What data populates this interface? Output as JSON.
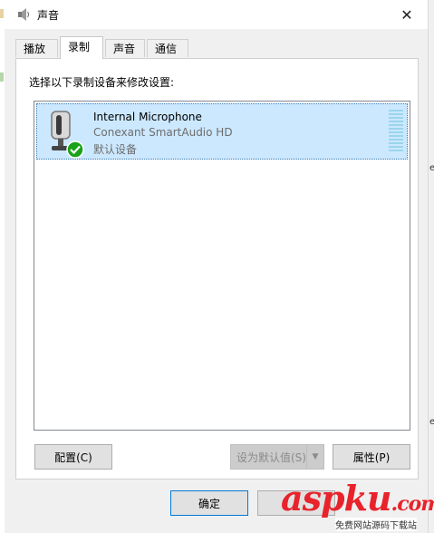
{
  "window": {
    "title": "声音",
    "close_glyph": "✕"
  },
  "tabs": [
    {
      "label": "播放",
      "active": false
    },
    {
      "label": "录制",
      "active": true
    },
    {
      "label": "声音",
      "active": false
    },
    {
      "label": "通信",
      "active": false
    }
  ],
  "recording": {
    "instruction": "选择以下录制设备来修改设置:",
    "devices": [
      {
        "name": "Internal Microphone",
        "driver": "Conexant SmartAudio HD",
        "status": "默认设备",
        "icon": "microphone-icon",
        "badge": "default-check-icon"
      }
    ]
  },
  "buttons": {
    "configure": "配置(C)",
    "set_default": "设为默认值(S)",
    "properties": "属性(P)",
    "ok": "确定"
  },
  "watermark": {
    "text": "aspku",
    "suffix": ".com",
    "caption": "免费网站源码下载站"
  },
  "colors": {
    "selection": "#cce8ff",
    "meter": "#9ad5ee",
    "check": "#1aa31a",
    "watermark_red": "#e8232b"
  }
}
